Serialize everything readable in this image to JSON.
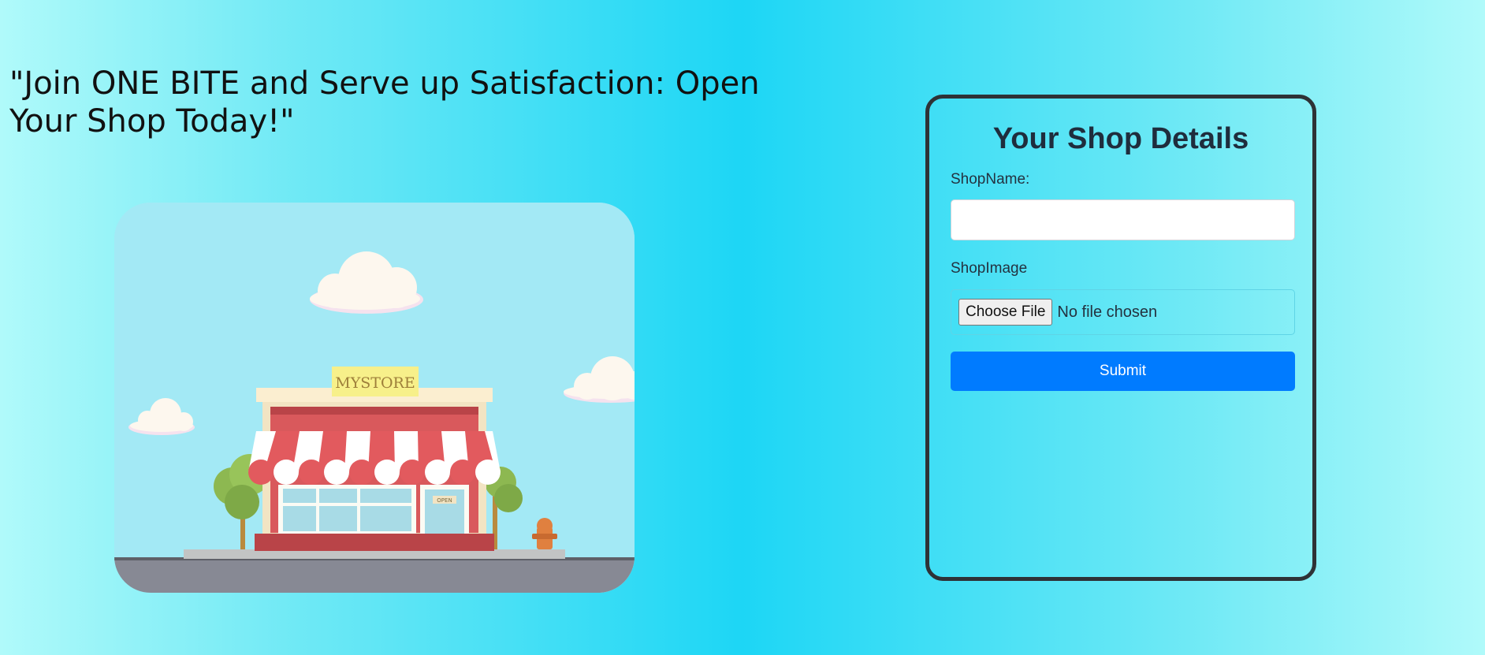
{
  "hero": {
    "tagline": "\"Join ONE BITE and Serve up Satisfaction: Open Your Shop Today!\"",
    "illustration": {
      "sign_text": "MYSTORE",
      "door_sign": "OPEN"
    }
  },
  "form": {
    "title": "Your Shop Details",
    "shop_name_label": "ShopName:",
    "shop_name_value": "",
    "shop_image_label": "ShopImage",
    "choose_file_label": "Choose File",
    "file_status": "No file chosen",
    "submit_label": "Submit"
  },
  "colors": {
    "accent": "#007bff",
    "card_border": "#2e3236"
  }
}
